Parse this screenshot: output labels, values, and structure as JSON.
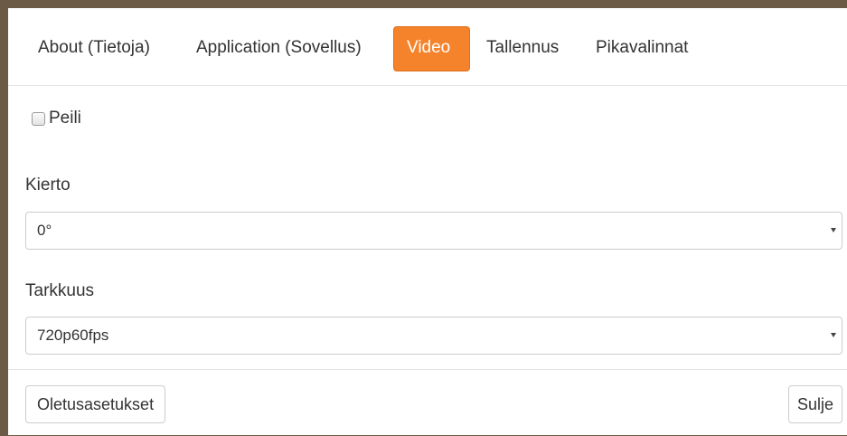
{
  "tabs": [
    {
      "label": "About (Tietoja)",
      "active": false
    },
    {
      "label": "Application (Sovellus)",
      "active": false
    },
    {
      "label": "Video",
      "active": true
    },
    {
      "label": "Tallennus",
      "active": false
    },
    {
      "label": "Pikavalinnat",
      "active": false
    }
  ],
  "mirror": {
    "label": "Peili",
    "checked": false
  },
  "rotation": {
    "label": "Kierto",
    "value": "0°"
  },
  "resolution": {
    "label": "Tarkkuus",
    "value": "720p60fps"
  },
  "footer": {
    "defaults_label": "Oletusasetukset",
    "close_label": "Sulje"
  },
  "colors": {
    "accent": "#f5832c",
    "backdrop": "#6b5a46"
  }
}
